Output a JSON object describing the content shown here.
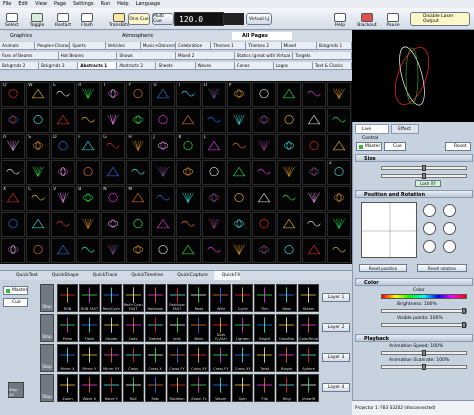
{
  "menu": [
    "File",
    "Edit",
    "View",
    "Page",
    "Settings",
    "Run",
    "Help",
    "Language"
  ],
  "toolbar": {
    "select": "Select",
    "toggle": "Toggle",
    "restart": "Restart",
    "flash": "Flash",
    "trans_bits": "TransBits",
    "one_cue": "One Cue",
    "multi_cue": "Multi Cue",
    "bpm": "120.0",
    "virtual_lj": "Virtual LJ",
    "help": "Help",
    "blackout": "Blackout",
    "pause": "Pause",
    "disable_laser": "Disable Laser Output"
  },
  "page_tabs": [
    "Graphics",
    "Atmospheric",
    "All Pages"
  ],
  "category_rows": [
    [
      "Animals",
      "People+Characters",
      "Sports",
      "Vehicles",
      "Music+Dancers",
      "Celebration",
      "Themes 1",
      "Themes 2",
      "Mixed",
      "Bckgrnds 1"
    ],
    [
      "Fans of Beams",
      "Hot Beams",
      "Shows",
      "Mixed 2",
      "Statics (great with Virtual LJ)",
      "Targets"
    ],
    [
      "Bckgrnds 2",
      "Bckgrnds 3",
      "Abstracts 1",
      "Abstracts 2",
      "Sheets",
      "Waves",
      "Cones",
      "Logos",
      "Text & Clocks"
    ]
  ],
  "grid_labels": [
    "Q",
    "W",
    "E",
    "R",
    "T",
    "Y",
    "U",
    "I",
    "O",
    "P",
    "",
    "",
    "",
    "",
    "",
    "",
    "",
    "",
    "",
    "",
    "",
    "",
    "",
    "",
    "",
    "",
    "",
    "",
    "A",
    "S",
    "D",
    "F",
    "G",
    "H",
    "J",
    "K",
    "L",
    "",
    "",
    "",
    "",
    "",
    "",
    "",
    "",
    "",
    "",
    "",
    "",
    "",
    "",
    "",
    "",
    "",
    "",
    "Z",
    "X",
    "C",
    "V",
    "B",
    "N",
    "M",
    "",
    "",
    "",
    "",
    "",
    "",
    "",
    "",
    "",
    "",
    "",
    "",
    "",
    "",
    "",
    "",
    "",
    "",
    "",
    "",
    ""
  ],
  "right_panel": {
    "live_control": "Live Control",
    "effect": "Effect",
    "master": "Master",
    "cue": "Cue",
    "reset": "Reset",
    "size_head": "Size",
    "lock_xy": "Lock XY",
    "position_head": "Position and Rotation",
    "reset_position": "Reset position",
    "reset_rotation": "Reset rotation",
    "color_head": "Color",
    "color_label": "Color",
    "brightness": "Brightness: 100%",
    "visible_points": "Visible points: 100%",
    "playback_head": "Playback",
    "anim_speed": "Animation Speed: 100%",
    "anim_scanrate": "Animation Scanrate: 100%",
    "status": "Projector 1: FB3 S3202 (disconnected)"
  },
  "bottom_tabs": [
    "QuickText",
    "QuickShape",
    "QuickTrace",
    "QuickTimeline",
    "QuickCapture",
    "QuickFX"
  ],
  "bottom_side": {
    "master": "Master",
    "cue": "Cue",
    "stop_all": "Stop All"
  },
  "stop_label": "Stop",
  "layers": [
    "Layer 1",
    "Layer 2",
    "Layer 3",
    "Layer 4"
  ],
  "fx_rows": [
    [
      "RGB",
      "RGB FAST",
      "Red/Cyan",
      "Red+Cyan FAST",
      "Rainbow",
      "Rainbow FAST",
      "Reds",
      "Wild",
      "Cycle",
      "Thin",
      "Wow",
      "Steam"
    ],
    [
      "Pulse",
      "Flash",
      "Strobe",
      "Dots",
      "Dotted",
      "Jelly",
      "Blink",
      "Dots FLASH",
      "Lighten",
      "Bright",
      "ColorBar",
      "ColorTemp"
    ],
    [
      "Mirror X",
      "Mirror Y",
      "Mirror XY",
      "Cross",
      "Cross X",
      "Cross FY",
      "Cross XY",
      "Cross FY",
      "Cross XY",
      "Twist",
      "Ripple",
      "Sphere"
    ],
    [
      "Zoom",
      "Wave X",
      "Wave Y",
      "Roll",
      "Fast",
      "Rotation",
      "Zoom FL",
      "Waver",
      "Spin",
      "Flip",
      "Ring",
      "Unswift"
    ]
  ]
}
